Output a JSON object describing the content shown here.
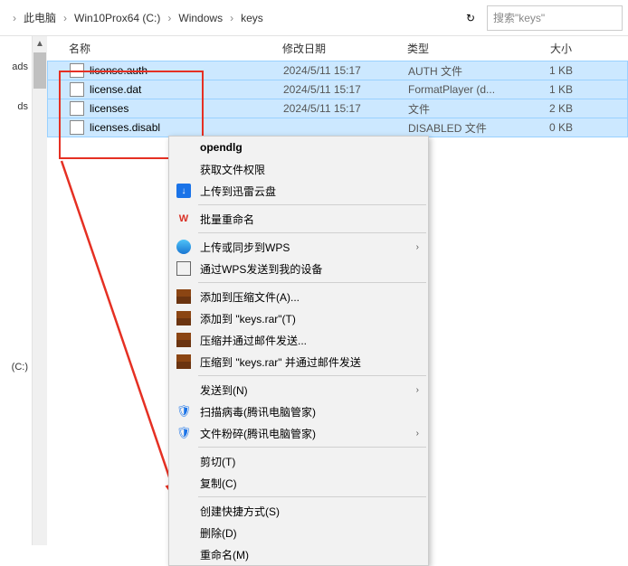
{
  "breadcrumb": {
    "item1": "此电脑",
    "item2": "Win10Prox64 (C:)",
    "item3": "Windows",
    "item4": "keys"
  },
  "search": {
    "placeholder": "搜索\"keys\""
  },
  "headers": {
    "name": "名称",
    "date": "修改日期",
    "type": "类型",
    "size": "大小"
  },
  "sidebar": {
    "a": "ads",
    "b": " ",
    "c": "ds",
    "d": "(C:)"
  },
  "files": [
    {
      "name": "license.auth",
      "date": "2024/5/11 15:17",
      "type": "AUTH 文件",
      "size": "1 KB"
    },
    {
      "name": "license.dat",
      "date": "2024/5/11 15:17",
      "type": "FormatPlayer (d...",
      "size": "1 KB"
    },
    {
      "name": "licenses",
      "date": "2024/5/11 15:17",
      "type": "文件",
      "size": "2 KB"
    },
    {
      "name": "licenses.disabl",
      "date": "",
      "type": "DISABLED 文件",
      "size": "0 KB"
    }
  ],
  "menu": {
    "opendlg": "opendlg",
    "getPerm": "获取文件权限",
    "xunlei": "上传到迅雷云盘",
    "batchRename": "批量重命名",
    "syncWps": "上传或同步到WPS",
    "sendWps": "通过WPS发送到我的设备",
    "addArchive": "添加到压缩文件(A)...",
    "addKeys": "添加到 \"keys.rar\"(T)",
    "zipMail": "压缩并通过邮件发送...",
    "zipKeysMail": "压缩到 \"keys.rar\" 并通过邮件发送",
    "sendTo": "发送到(N)",
    "scan": "扫描病毒(腾讯电脑管家)",
    "shred": "文件粉碎(腾讯电脑管家)",
    "cut": "剪切(T)",
    "copy": "复制(C)",
    "shortcut": "创建快捷方式(S)",
    "delete": "删除(D)",
    "rename": "重命名(M)"
  }
}
